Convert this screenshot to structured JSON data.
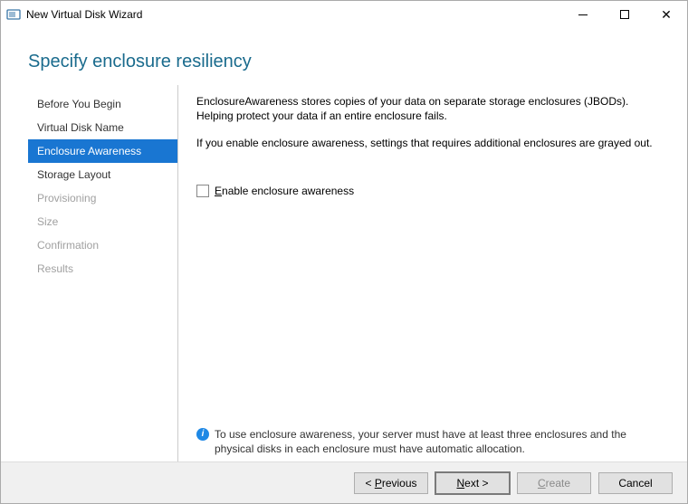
{
  "window": {
    "title": "New Virtual Disk Wizard"
  },
  "header": {
    "title": "Specify enclosure resiliency"
  },
  "sidebar": {
    "items": [
      {
        "label": "Before You Begin",
        "state": "normal"
      },
      {
        "label": "Virtual Disk Name",
        "state": "normal"
      },
      {
        "label": "Enclosure Awareness",
        "state": "selected"
      },
      {
        "label": "Storage Layout",
        "state": "normal"
      },
      {
        "label": "Provisioning",
        "state": "disabled"
      },
      {
        "label": "Size",
        "state": "disabled"
      },
      {
        "label": "Confirmation",
        "state": "disabled"
      },
      {
        "label": "Results",
        "state": "disabled"
      }
    ]
  },
  "content": {
    "paragraph1": "EnclosureAwareness stores copies of your data on separate storage enclosures (JBODs). Helping protect your data if an entire enclosure fails.",
    "paragraph2": "If you enable enclosure awareness, settings that requires additional enclosures are grayed out.",
    "checkbox_label": "Enable enclosure awareness",
    "checkbox_checked": false,
    "info_text": "To use enclosure awareness, your server must have at least three enclosures and the physical disks in each enclosure must have automatic allocation."
  },
  "footer": {
    "previous_prefix": "< ",
    "previous_letter": "P",
    "previous_rest": "revious",
    "next_letter": "N",
    "next_rest": "ext >",
    "create_letter": "C",
    "create_rest": "reate",
    "cancel": "Cancel",
    "create_enabled": false
  }
}
